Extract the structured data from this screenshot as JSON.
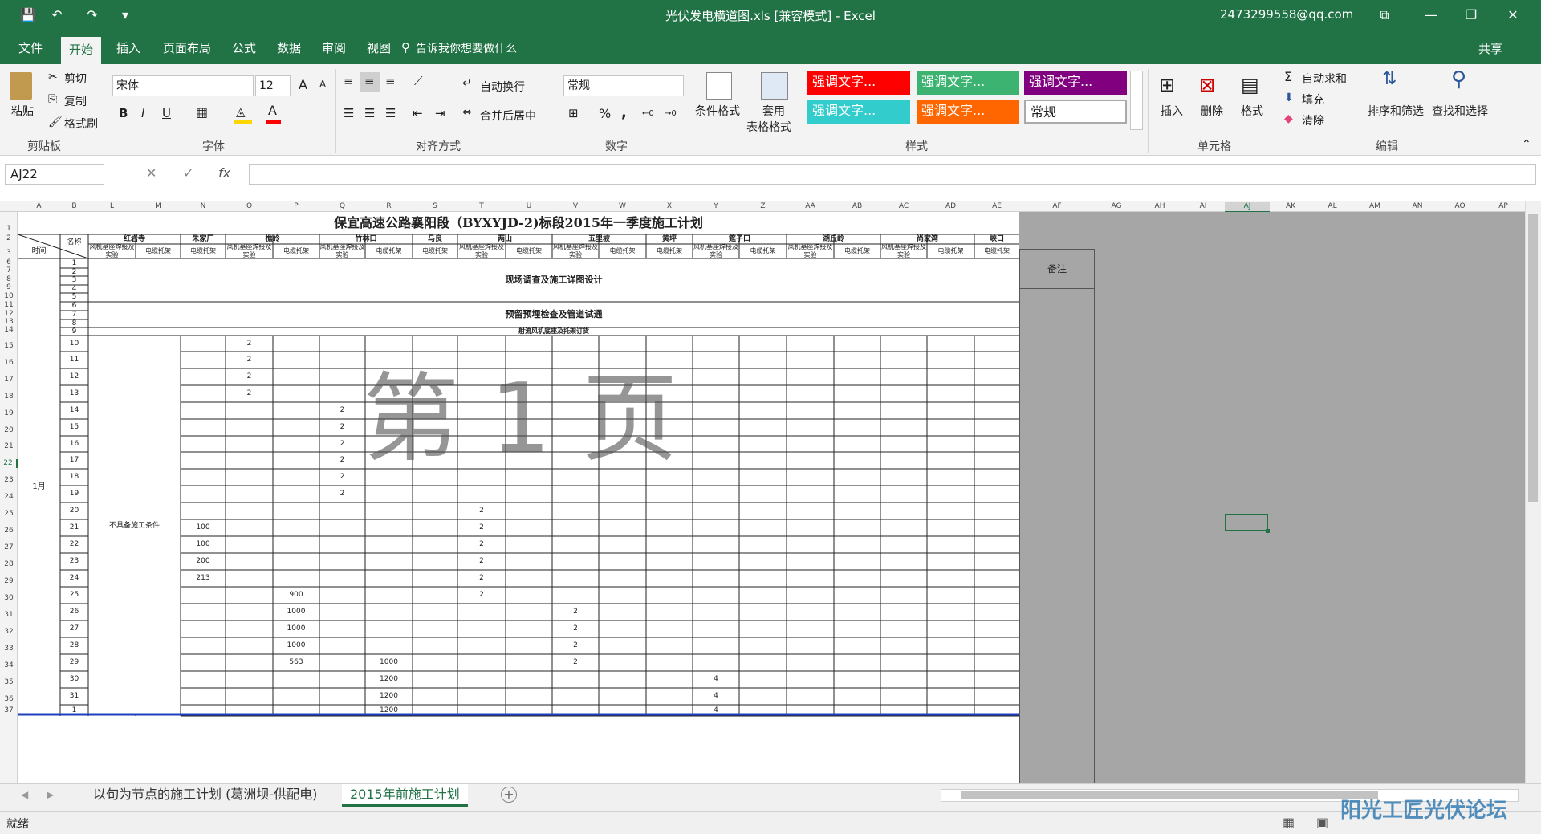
{
  "window": {
    "title": "光伏发电横道图.xls  [兼容模式]  -  Excel",
    "user": "2473299558@qq.com",
    "qat_glyphs": {
      "save": "💾",
      "undo": "↶",
      "redo": "↷",
      "custom": "▾"
    },
    "controls": {
      "ribbon_display": "⧉",
      "minimize": "—",
      "restore": "❐",
      "close": "✕"
    }
  },
  "tabs": [
    "文件",
    "开始",
    "插入",
    "页面布局",
    "公式",
    "数据",
    "审阅",
    "视图"
  ],
  "tellme": "告诉我你想要做什么",
  "share": "共享",
  "ribbon": {
    "clipboard": {
      "paste": "粘贴",
      "cut": "剪切",
      "copy": "复制",
      "format_painter": "格式刷",
      "group": "剪贴板"
    },
    "font": {
      "name": "宋体",
      "size": "12",
      "group": "字体",
      "bold": "B",
      "italic": "I",
      "underline": "U",
      "grow": "A",
      "shrink": "A"
    },
    "alignment": {
      "wrap": "自动换行",
      "merge": "合并后居中",
      "group": "对齐方式"
    },
    "number": {
      "format": "常规",
      "group": "数字",
      "percent": "%",
      "comma": ","
    },
    "styles": {
      "conditional": "条件格式",
      "table_line1": "套用",
      "table_line2": "表格格式",
      "cells": [
        {
          "label": "强调文字...",
          "bg": "#ff0000"
        },
        {
          "label": "强调文字...",
          "bg": "#3cb371"
        },
        {
          "label": "强调文字...",
          "bg": "#800080"
        },
        {
          "label": "强调文字...",
          "bg": "#33cccc"
        },
        {
          "label": "强调文字...",
          "bg": "#ff6600"
        },
        {
          "label": "常规",
          "bg": "#ffffff"
        }
      ],
      "group": "样式"
    },
    "cells": {
      "insert": "插入",
      "delete": "删除",
      "format": "格式",
      "group": "单元格"
    },
    "editing": {
      "autosum": "自动求和",
      "fill": "填充",
      "clear": "清除",
      "sort": "排序和筛选",
      "find": "查找和选择",
      "group": "编辑"
    }
  },
  "formula_bar": {
    "name_box": "AJ22",
    "fx": "fx",
    "value": ""
  },
  "columns": [
    "A",
    "B",
    "L",
    "M",
    "N",
    "O",
    "P",
    "Q",
    "R",
    "S",
    "T",
    "U",
    "V",
    "W",
    "X",
    "Y",
    "Z",
    "AA",
    "AB",
    "AC",
    "AD",
    "AE",
    "AF",
    "AG",
    "AH",
    "AI",
    "AJ",
    "AK",
    "AL",
    "AM",
    "AN",
    "AO",
    "AP"
  ],
  "rows": [
    "1",
    "2",
    "3",
    "6",
    "7",
    "8",
    "9",
    "10",
    "11",
    "12",
    "13",
    "14",
    "15",
    "16",
    "17",
    "18",
    "19",
    "20",
    "21",
    "22",
    "23",
    "24",
    "25",
    "26",
    "27",
    "28",
    "29",
    "30",
    "31",
    "32",
    "33",
    "34",
    "35",
    "36",
    "37"
  ],
  "sheet": {
    "title": "保宜高速公路襄阳段（BYXYJD-2)标段2015年一季度施工计划",
    "header_time": "时间",
    "header_name": "名称",
    "remark": "备注",
    "locations": [
      "红岩寺",
      "朱家厂",
      "樵岭",
      "竹林口",
      "马良",
      "两山",
      "五里坡",
      "黄坪",
      "筵子口",
      "湖丘岭",
      "尚家湾",
      "峡口"
    ],
    "sub_a": "风机基座焊接及实验",
    "sub_b": "电缆托架",
    "month": "1月",
    "no_condition": "不具备施工条件",
    "span1": "现场调查及施工详图设计",
    "span2": "预留预埋检查及管道试通",
    "span3": "射流风机底座及托架订货",
    "day_numbers": [
      "1",
      "2",
      "3",
      "4",
      "5",
      "6",
      "7",
      "8",
      "9",
      "10",
      "11",
      "12",
      "13",
      "14",
      "15",
      "16",
      "17",
      "18",
      "19",
      "20",
      "21",
      "22",
      "23",
      "24",
      "25",
      "26",
      "27",
      "28",
      "29",
      "30",
      "31",
      "1"
    ],
    "values": {
      "O": [
        "2",
        "2",
        "2",
        "2"
      ],
      "Q": [
        "2",
        "2",
        "2",
        "2",
        "2",
        "2"
      ],
      "N": [
        "100",
        "100",
        "200",
        "213"
      ],
      "T": [
        "2",
        "2",
        "2",
        "2",
        "2",
        "2"
      ],
      "P": [
        "900",
        "1000",
        "1000",
        "1000",
        "563"
      ],
      "V": [
        "2",
        "2",
        "2",
        "2"
      ],
      "R": [
        "1000",
        "1200",
        "1200",
        "1200"
      ],
      "Y": [
        "4",
        "4",
        "4"
      ]
    },
    "watermark": "第 1 页"
  },
  "sheet_tabs": [
    "以旬为节点的施工计划 (葛洲坝-供配电)",
    "2015年前施工计划"
  ],
  "add_sheet": "+",
  "status": {
    "ready": "就绪"
  },
  "forum_watermark": "阳光工匠光伏论坛"
}
